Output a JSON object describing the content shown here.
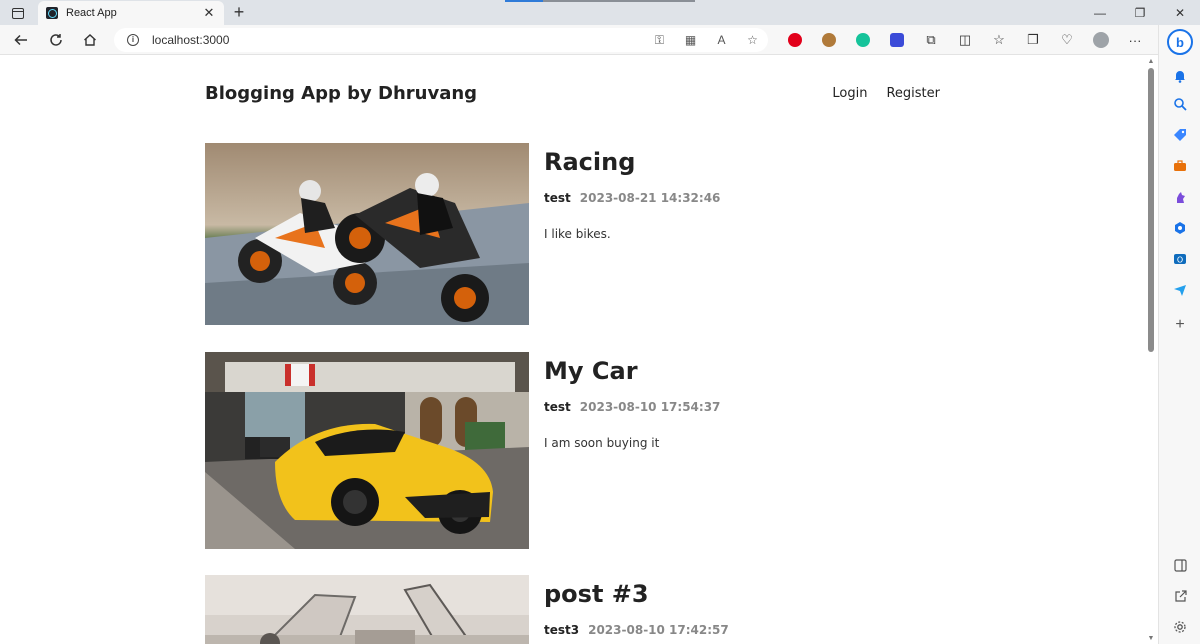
{
  "browser": {
    "tab_title": "React App",
    "tab_close": "✕",
    "new_tab": "+",
    "url": "localhost:3000",
    "window_controls": [
      "—",
      "❐",
      "✕"
    ],
    "icons": {
      "back": "back-arrow-icon",
      "refresh": "refresh-icon",
      "home": "home-icon",
      "info": "info-icon",
      "key": "key-icon",
      "app": "app-available-icon",
      "read_aloud": "read-aloud-icon",
      "favorite": "favorite-star-icon"
    },
    "extension_colors": {
      "opera": "#e2001a",
      "cookie": "#b07a3a",
      "grammarly": "#15c39a",
      "extension": "#3b4bd8"
    }
  },
  "sidebar": {
    "bing_label": "b",
    "item_colors": {
      "bell": "#1a73e8",
      "search": "#1a73e8",
      "tag": "#3a86ff",
      "tools": "#e8710a",
      "games": "#7b4ddb",
      "office": "#1a73e8",
      "outlook": "#0f6cbd",
      "send": "#24a0ed"
    }
  },
  "header": {
    "logo": "Blogging App by Dhruvang",
    "nav": {
      "login": "Login",
      "register": "Register"
    }
  },
  "posts": [
    {
      "title": "Racing",
      "author": "test",
      "time": "2023-08-21 14:32:46",
      "summary": "I like bikes."
    },
    {
      "title": "My Car",
      "author": "test",
      "time": "2023-08-10 17:54:37",
      "summary": "I am soon buying it"
    },
    {
      "title": "post #3",
      "author": "test3",
      "time": "2023-08-10 17:42:57",
      "summary": ""
    }
  ]
}
